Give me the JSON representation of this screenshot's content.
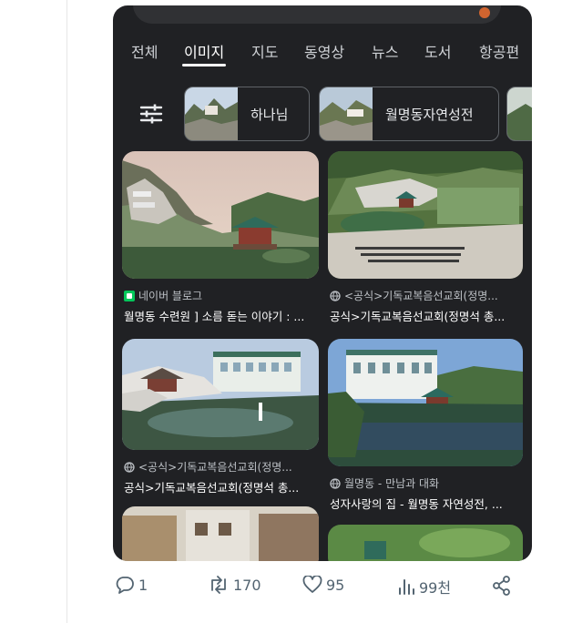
{
  "tabs": [
    {
      "label": "전체"
    },
    {
      "label": "이미지"
    },
    {
      "label": "지도"
    },
    {
      "label": "동영상"
    },
    {
      "label": "뉴스"
    },
    {
      "label": "도서"
    },
    {
      "label": "항공편"
    }
  ],
  "active_tab": "이미지",
  "chips": [
    {
      "label": "하나님"
    },
    {
      "label": "월명동자연성전"
    }
  ],
  "results": [
    {
      "source": "네이버 블로그",
      "caption": "월명동 수련원 ] 소름 돋는 이야기 : ..."
    },
    {
      "source": "<공식>기독교복음선교회(정명...",
      "caption": "공식>기독교복음선교회(정명석 총..."
    },
    {
      "source": "<공식>기독교복음선교회(정명...",
      "caption": "공식>기독교복음선교회(정명석 총..."
    },
    {
      "source": "월명동 - 만남과 대화",
      "caption": "성자사랑의 집 - 월명동 자연성전, ..."
    }
  ],
  "tweet_actions": {
    "replies": "1",
    "reposts": "170",
    "likes": "95",
    "views": "99천"
  },
  "colors": {
    "panel_bg": "#202124",
    "accent_naver": "#03c75a",
    "action_gray": "#536471"
  }
}
